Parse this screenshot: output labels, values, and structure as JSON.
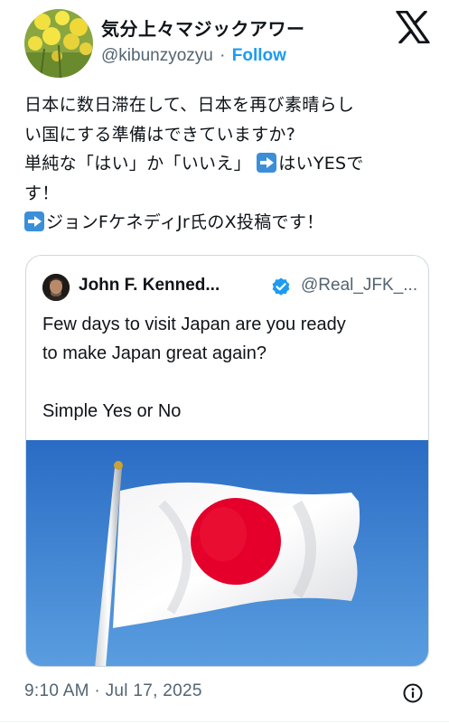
{
  "author": {
    "display_name": "気分上々マジックアワー",
    "handle": "@kibunzyozyu",
    "separator": "·",
    "follow_label": "Follow",
    "avatar_icon": "rapeseed-flowers-avatar"
  },
  "tweet": {
    "lines": [
      "日本に数日滞在して、日本を再び素晴らし",
      "い国にする準備はできていますか?",
      "単純な「はい」か「いいえ」",
      "はいYESで",
      "す！",
      "ジョンFケネディJr氏のX投稿です！"
    ]
  },
  "quote": {
    "display_name": "John F. Kenned...",
    "handle": "@Real_JFK_...",
    "verified": true,
    "text_lines": [
      "Few days to visit Japan are you ready",
      "to make Japan great again?",
      "Simple Yes or No"
    ],
    "image_icon": "japan-flag-photo"
  },
  "footer": {
    "timestamp": "9:10 AM · Jul 17, 2025"
  },
  "colors": {
    "link_blue": "#1d9bf0",
    "muted_text": "#536471",
    "border": "#cfd9de",
    "flag_red": "#e4002b",
    "sky_blue": "#2f74c9"
  }
}
